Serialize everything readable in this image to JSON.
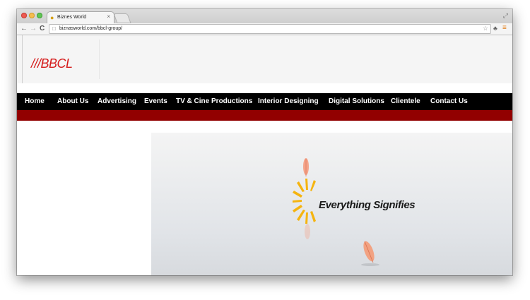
{
  "browser": {
    "tab_title": "Biznes World",
    "tab_close": "×",
    "url": "biznasworld.com/bbcl-group/"
  },
  "page": {
    "logo": "///BBCL",
    "nav": [
      "Home",
      "About Us",
      "Advertising",
      "Events",
      "TV & Cine Productions",
      "Interior Designing",
      "Digital Solutions",
      "Clientele",
      "Contact Us"
    ],
    "hero_tagline": "Everything Signifies"
  },
  "colors": {
    "accent_red": "#d51a1a",
    "nav_bg": "#000000",
    "stripe": "#920000",
    "sun": "#f5b40f"
  }
}
